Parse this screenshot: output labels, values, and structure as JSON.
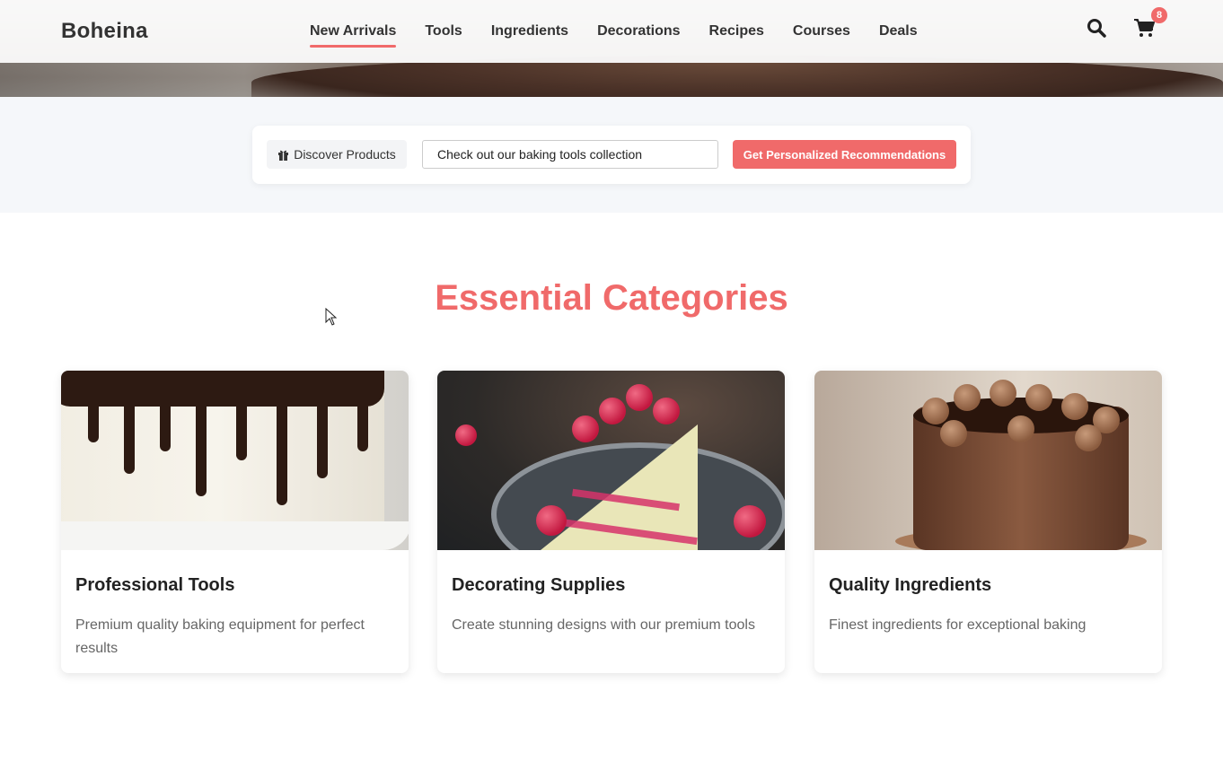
{
  "brand": {
    "name": "Boheina",
    "accent": "#f06a6a"
  },
  "nav": {
    "items": [
      {
        "label": "New Arrivals",
        "active": true
      },
      {
        "label": "Tools",
        "active": false
      },
      {
        "label": "Ingredients",
        "active": false
      },
      {
        "label": "Decorations",
        "active": false
      },
      {
        "label": "Recipes",
        "active": false
      },
      {
        "label": "Courses",
        "active": false
      },
      {
        "label": "Deals",
        "active": false
      }
    ]
  },
  "header_icons": {
    "search": "search-icon",
    "cart": "cart-icon",
    "cart_count": "8"
  },
  "search_bar": {
    "discover_label": "Discover Products",
    "discover_icon": "gift-icon",
    "input_value": "Check out our baking tools collection",
    "cta_label": "Get Personalized Recommendations"
  },
  "categories": {
    "title": "Essential Categories",
    "cards": [
      {
        "title": "Professional Tools",
        "description": "Premium quality baking equipment for perfect results"
      },
      {
        "title": "Decorating Supplies",
        "description": "Create stunning designs with our premium tools"
      },
      {
        "title": "Quality Ingredients",
        "description": "Finest ingredients for exceptional baking"
      }
    ]
  }
}
